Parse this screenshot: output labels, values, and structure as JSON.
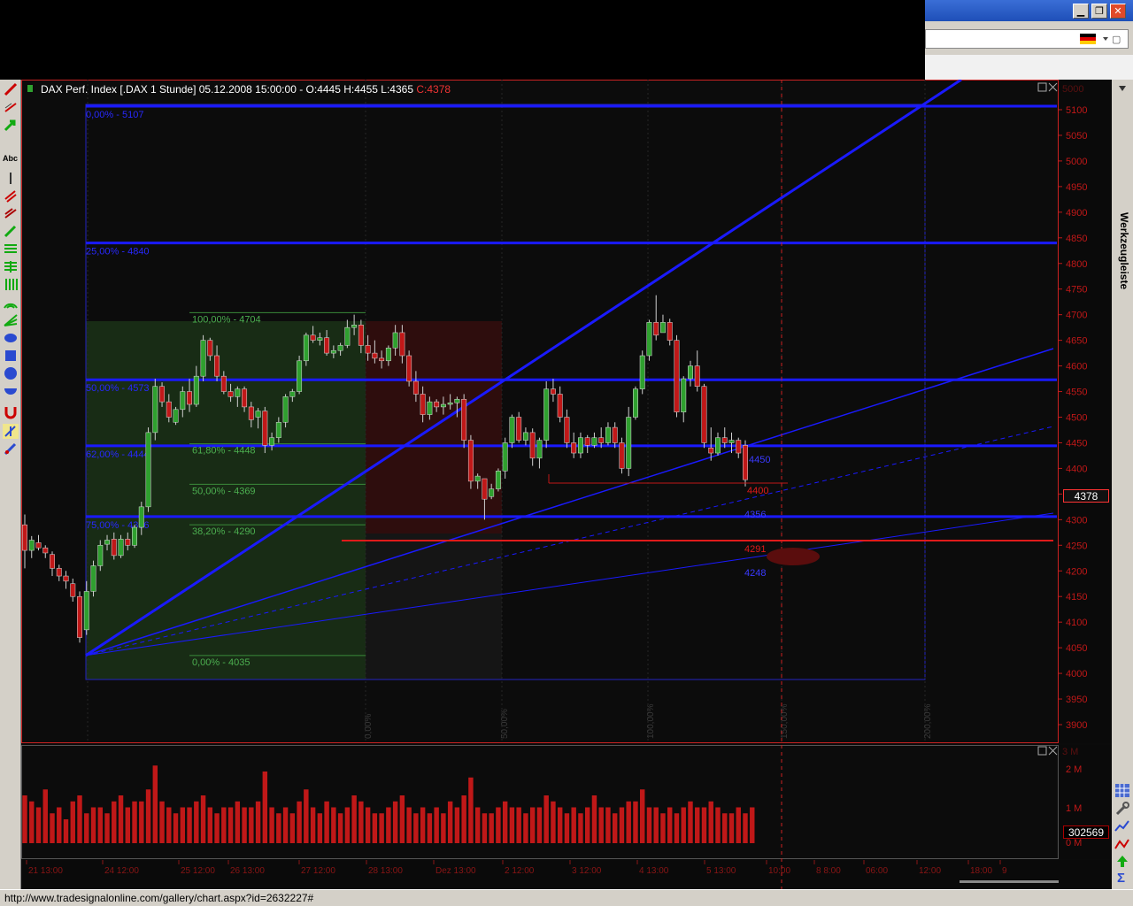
{
  "chart_header": {
    "title": "DAX Perf. Index [.DAX  1 Stunde] 05.12.2008 15:00:00 - ",
    "open": "O:4445",
    "high": "H:4455",
    "low": "L:4365",
    "close": "C:4378"
  },
  "fib_blue": [
    {
      "label": "0,00% - 5107",
      "value": 5107
    },
    {
      "label": "25,00% - 4840",
      "value": 4840
    },
    {
      "label": "50,00% - 4573",
      "value": 4573
    },
    {
      "label": "62,00% - 4444",
      "value": 4444
    },
    {
      "label": "75,00% - 4306",
      "value": 4306
    }
  ],
  "fib_green": [
    {
      "label": "100,00% - 4704",
      "value": 4704
    },
    {
      "label": "61,80% - 4448",
      "value": 4448
    },
    {
      "label": "50,00% - 4369",
      "value": 4369
    },
    {
      "label": "38,20% - 4290",
      "value": 4290
    },
    {
      "label": "0,00% - 4035",
      "value": 4035
    }
  ],
  "annotations": {
    "a4450": "4450",
    "a4400": "4400",
    "a4356": "4356",
    "a4291": "4291",
    "a4248": "4248"
  },
  "time_fib": [
    "0,00%",
    "50,00%",
    "100,00%",
    "150,00%",
    "200,00%"
  ],
  "price_axis": {
    "ticks": [
      "5100",
      "5050",
      "5000",
      "4950",
      "4900",
      "4850",
      "4800",
      "4750",
      "4700",
      "4650",
      "4600",
      "4550",
      "4500",
      "4450",
      "4400",
      "4350",
      "4300",
      "4250",
      "4200",
      "4150",
      "4100",
      "4050",
      "4000",
      "3950",
      "3900"
    ],
    "top_faded": "5000"
  },
  "last_price": "4378",
  "volume_axis": {
    "ticks": [
      "2 M",
      "1 M",
      "0 M"
    ],
    "top_faded": "3 M",
    "last_volume": "302569"
  },
  "time_axis": {
    "labels": [
      "21 13:00",
      "24 12:00",
      "25 12:00",
      "26 13:00",
      "27 12:00",
      "28 13:00",
      "Dez 13:00",
      "2   12:00",
      "3   12:00",
      "4   13:00",
      "5   13:00",
      "10:00",
      "8   8:00",
      "06:00",
      "12:00",
      "18:00",
      "9"
    ]
  },
  "right_toolbar": {
    "label": "Werkzeugleiste"
  },
  "status": {
    "url": "http://www.tradesignalonline.com/gallery/chart.aspx?id=2632227#"
  },
  "window_buttons": {
    "minimize": "▁",
    "restore": "❐",
    "close": "✕"
  },
  "colors": {
    "up": "#2fa02f",
    "down": "#c01818",
    "fib_blue": "#1a1aff",
    "fib_green": "#4caf50",
    "accent_red": "#e01a1a"
  },
  "chart_data": {
    "type": "candlestick",
    "title": "DAX Perf. Index [.DAX  1 Stunde]",
    "ylim": [
      3880,
      5190
    ],
    "candles": [
      [
        4290,
        4310,
        4205,
        4240
      ],
      [
        4240,
        4268,
        4225,
        4260
      ],
      [
        4255,
        4270,
        4240,
        4245
      ],
      [
        4245,
        4250,
        4225,
        4235
      ],
      [
        4232,
        4238,
        4190,
        4205
      ],
      [
        4205,
        4212,
        4180,
        4190
      ],
      [
        4190,
        4200,
        4165,
        4180
      ],
      [
        4175,
        4185,
        4140,
        4150
      ],
      [
        4150,
        4160,
        4060,
        4070
      ],
      [
        4085,
        4180,
        4075,
        4160
      ],
      [
        4160,
        4220,
        4150,
        4210
      ],
      [
        4210,
        4260,
        4200,
        4250
      ],
      [
        4252,
        4270,
        4240,
        4260
      ],
      [
        4262,
        4275,
        4222,
        4230
      ],
      [
        4230,
        4270,
        4225,
        4262
      ],
      [
        4262,
        4275,
        4240,
        4250
      ],
      [
        4250,
        4290,
        4245,
        4285
      ],
      [
        4285,
        4335,
        4270,
        4325
      ],
      [
        4325,
        4480,
        4315,
        4470
      ],
      [
        4470,
        4575,
        4455,
        4560
      ],
      [
        4560,
        4568,
        4520,
        4530
      ],
      [
        4530,
        4545,
        4490,
        4500
      ],
      [
        4490,
        4520,
        4485,
        4515
      ],
      [
        4515,
        4560,
        4500,
        4550
      ],
      [
        4550,
        4575,
        4510,
        4525
      ],
      [
        4525,
        4600,
        4520,
        4580
      ],
      [
        4580,
        4660,
        4570,
        4650
      ],
      [
        4650,
        4655,
        4610,
        4620
      ],
      [
        4620,
        4640,
        4570,
        4580
      ],
      [
        4580,
        4590,
        4545,
        4550
      ],
      [
        4550,
        4565,
        4530,
        4540
      ],
      [
        4540,
        4560,
        4520,
        4555
      ],
      [
        4555,
        4560,
        4510,
        4520
      ],
      [
        4520,
        4530,
        4480,
        4495
      ],
      [
        4500,
        4518,
        4478,
        4512
      ],
      [
        4512,
        4520,
        4430,
        4445
      ],
      [
        4445,
        4470,
        4435,
        4460
      ],
      [
        4460,
        4500,
        4450,
        4490
      ],
      [
        4490,
        4545,
        4480,
        4540
      ],
      [
        4540,
        4555,
        4530,
        4550
      ],
      [
        4550,
        4620,
        4545,
        4610
      ],
      [
        4610,
        4665,
        4600,
        4660
      ],
      [
        4660,
        4678,
        4645,
        4650
      ],
      [
        4650,
        4665,
        4640,
        4655
      ],
      [
        4655,
        4670,
        4620,
        4625
      ],
      [
        4625,
        4640,
        4615,
        4630
      ],
      [
        4630,
        4645,
        4620,
        4640
      ],
      [
        4640,
        4690,
        4635,
        4675
      ],
      [
        4675,
        4700,
        4660,
        4680
      ],
      [
        4680,
        4690,
        4625,
        4640
      ],
      [
        4640,
        4660,
        4610,
        4625
      ],
      [
        4625,
        4650,
        4605,
        4615
      ],
      [
        4615,
        4630,
        4595,
        4610
      ],
      [
        4610,
        4640,
        4600,
        4635
      ],
      [
        4635,
        4680,
        4620,
        4665
      ],
      [
        4665,
        4680,
        4605,
        4620
      ],
      [
        4620,
        4630,
        4560,
        4570
      ],
      [
        4570,
        4590,
        4530,
        4545
      ],
      [
        4545,
        4560,
        4490,
        4505
      ],
      [
        4505,
        4540,
        4495,
        4530
      ],
      [
        4530,
        4535,
        4510,
        4520
      ],
      [
        4520,
        4540,
        4505,
        4525
      ],
      [
        4525,
        4545,
        4515,
        4528
      ],
      [
        4528,
        4540,
        4500,
        4535
      ],
      [
        4535,
        4545,
        4440,
        4455
      ],
      [
        4455,
        4465,
        4360,
        4375
      ],
      [
        4375,
        4390,
        4360,
        4385
      ],
      [
        4380,
        4360,
        4300,
        4340
      ],
      [
        4345,
        4370,
        4340,
        4360
      ],
      [
        4360,
        4400,
        4355,
        4395
      ],
      [
        4395,
        4460,
        4380,
        4450
      ],
      [
        4450,
        4505,
        4440,
        4500
      ],
      [
        4500,
        4510,
        4450,
        4455
      ],
      [
        4455,
        4480,
        4445,
        4470
      ],
      [
        4470,
        4478,
        4405,
        4420
      ],
      [
        4420,
        4460,
        4400,
        4455
      ],
      [
        4455,
        4570,
        4440,
        4555
      ],
      [
        4555,
        4575,
        4530,
        4545
      ],
      [
        4545,
        4560,
        4490,
        4500
      ],
      [
        4500,
        4515,
        4440,
        4450
      ],
      [
        4450,
        4470,
        4420,
        4430
      ],
      [
        4430,
        4470,
        4420,
        4460
      ],
      [
        4460,
        4465,
        4430,
        4445
      ],
      [
        4445,
        4470,
        4440,
        4460
      ],
      [
        4460,
        4480,
        4440,
        4450
      ],
      [
        4450,
        4490,
        4445,
        4480
      ],
      [
        4480,
        4490,
        4440,
        4450
      ],
      [
        4450,
        4460,
        4390,
        4400
      ],
      [
        4400,
        4520,
        4385,
        4500
      ],
      [
        4500,
        4560,
        4495,
        4555
      ],
      [
        4555,
        4630,
        4545,
        4620
      ],
      [
        4620,
        4690,
        4610,
        4685
      ],
      [
        4685,
        4738,
        4650,
        4660
      ],
      [
        4665,
        4700,
        4670,
        4685
      ],
      [
        4685,
        4692,
        4640,
        4650
      ],
      [
        4650,
        4660,
        4500,
        4510
      ],
      [
        4510,
        4580,
        4490,
        4575
      ],
      [
        4575,
        4610,
        4560,
        4600
      ],
      [
        4600,
        4630,
        4550,
        4560
      ],
      [
        4560,
        4565,
        4440,
        4450
      ],
      [
        4440,
        4480,
        4415,
        4430
      ],
      [
        4430,
        4470,
        4425,
        4460
      ],
      [
        4460,
        4480,
        4440,
        4450
      ],
      [
        4450,
        4470,
        4430,
        4455
      ],
      [
        4455,
        4460,
        4420,
        4430
      ],
      [
        4445,
        4455,
        4365,
        4378
      ]
    ],
    "volume": [
      40,
      35,
      30,
      45,
      25,
      30,
      20,
      35,
      40,
      25,
      30,
      30,
      25,
      35,
      40,
      30,
      35,
      35,
      45,
      65,
      35,
      30,
      25,
      30,
      30,
      35,
      40,
      30,
      25,
      30,
      30,
      35,
      30,
      30,
      35,
      60,
      30,
      25,
      30,
      25,
      35,
      45,
      30,
      25,
      35,
      30,
      25,
      30,
      40,
      35,
      30,
      25,
      25,
      30,
      35,
      40,
      30,
      25,
      30,
      25,
      30,
      25,
      35,
      30,
      40,
      55,
      30,
      25,
      25,
      30,
      35,
      30,
      30,
      25,
      30,
      30,
      40,
      35,
      30,
      25,
      30,
      25,
      30,
      40,
      30,
      30,
      25,
      30,
      35,
      35,
      45,
      30,
      30,
      25,
      30,
      25,
      30,
      35,
      30,
      30,
      35,
      30,
      25,
      25,
      30,
      25,
      30
    ],
    "volume_max_label": "2 M"
  }
}
